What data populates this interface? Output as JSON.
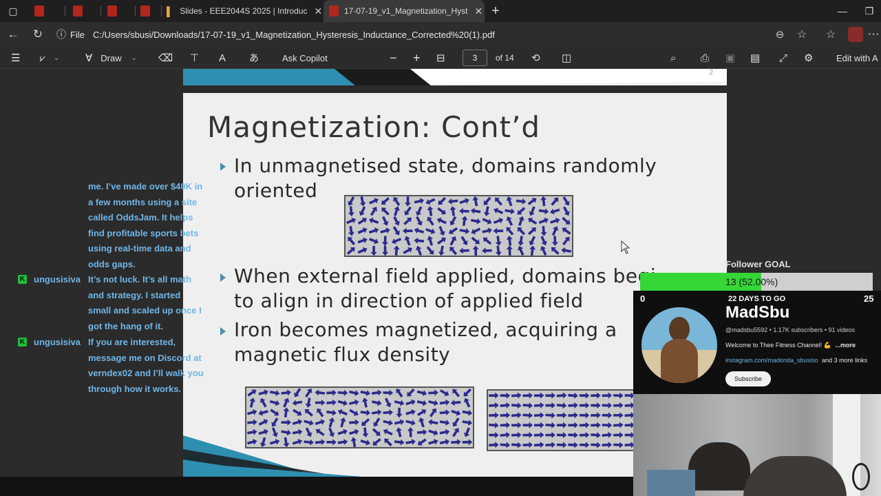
{
  "tabs": [
    {
      "label": ""
    },
    {
      "label": ""
    },
    {
      "label": ""
    },
    {
      "label": ""
    },
    {
      "label": "Slides - EEE2044S 2025 | Introduc"
    },
    {
      "label": "17-07-19_v1_Magnetization_Hyst"
    }
  ],
  "address": {
    "file_label": "File",
    "url": "C:/Users/sbusi/Downloads/17-07-19_v1_Magnetization_Hysteresis_Inductance_Corrected%20(1).pdf"
  },
  "toolbar": {
    "draw_label": "Draw",
    "copilot_label": "Ask Copilot",
    "page_current": "3",
    "page_total": "of 14",
    "edit_label": "Edit with A"
  },
  "slide": {
    "page_number": "2",
    "title": "Magnetization: Cont’d",
    "bullets": [
      {
        "line1": "In unmagnetised state, domains randomly",
        "line2": "oriented"
      },
      {
        "line1": "When external field applied, domains begi",
        "line2": "to align in direction of applied field"
      },
      {
        "line1": "Iron becomes magnetized, acquiring a",
        "line2": "magnetic flux density"
      }
    ]
  },
  "chat": {
    "cont_lines": [
      "me. I’ve made over $40K in",
      "a few months using a site",
      "called OddsJam. It helps",
      "find profitable sports bets",
      "using real-time data and",
      "odds gaps."
    ],
    "messages": [
      {
        "badge": "K",
        "user": "ungusisiva",
        "lines": [
          "It’s not luck. It’s all math",
          "and strategy. I started",
          "small and scaled up once I",
          "got the hang of it."
        ]
      },
      {
        "badge": "K",
        "user": "ungusisiva",
        "lines": [
          "If you are interested,",
          "message me on Discord at",
          "verndex02 and I’ll walk you",
          "through how it works."
        ]
      }
    ]
  },
  "goal": {
    "title": "Follower GOAL",
    "current_text": "13 (52.00%)",
    "progress": 0.52,
    "min": "0",
    "max": "25",
    "days_left": "22 DAYS TO GO"
  },
  "channel": {
    "name": "MadSbu",
    "meta": "@madsbu5592 • 1.17K subscribers • 91 videos",
    "description": "Welcome to Thee Fitness Channel! 💪",
    "more": "...more",
    "link": "instagram.com/madonda_sbusiso",
    "link_more": "and 3 more links",
    "subscribe_label": "Subscribe"
  },
  "colors": {
    "chat_text": "#6fb6e8",
    "goal_fill": "#36d636",
    "slide_accent": "#2f8fb0",
    "arrow": "#2b2a8c"
  }
}
